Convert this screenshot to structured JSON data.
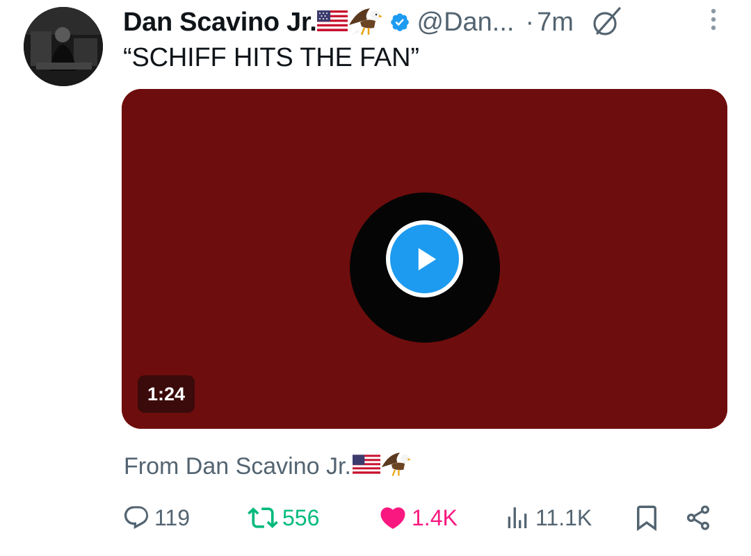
{
  "tweet": {
    "author": {
      "display_name": "Dan Scavino Jr.",
      "name_emojis": [
        "us-flag",
        "eagle"
      ],
      "verified": true,
      "handle": "@Dan...",
      "separator": "·",
      "time": "7m"
    },
    "text": "“SCHIFF HITS THE FAN”",
    "media": {
      "type": "video",
      "duration": "1:24"
    },
    "source": {
      "prefix": "From",
      "name": "Dan Scavino Jr."
    },
    "stats": {
      "replies": "119",
      "retweets": "556",
      "likes": "1.4K",
      "views": "11.1K"
    }
  },
  "colors": {
    "verified_blue": "#1d9bf0",
    "retweet_green": "#00ba7c",
    "like_pink": "#f91880",
    "muted_gray": "#536471",
    "text_dark": "#0f1419"
  },
  "icons": [
    "verified-badge-icon",
    "grok-icon",
    "more-vertical-icon",
    "play-icon",
    "reply-icon",
    "retweet-icon",
    "like-heart-icon",
    "views-icon",
    "bookmark-icon",
    "share-icon",
    "us-flag-icon",
    "eagle-icon"
  ]
}
